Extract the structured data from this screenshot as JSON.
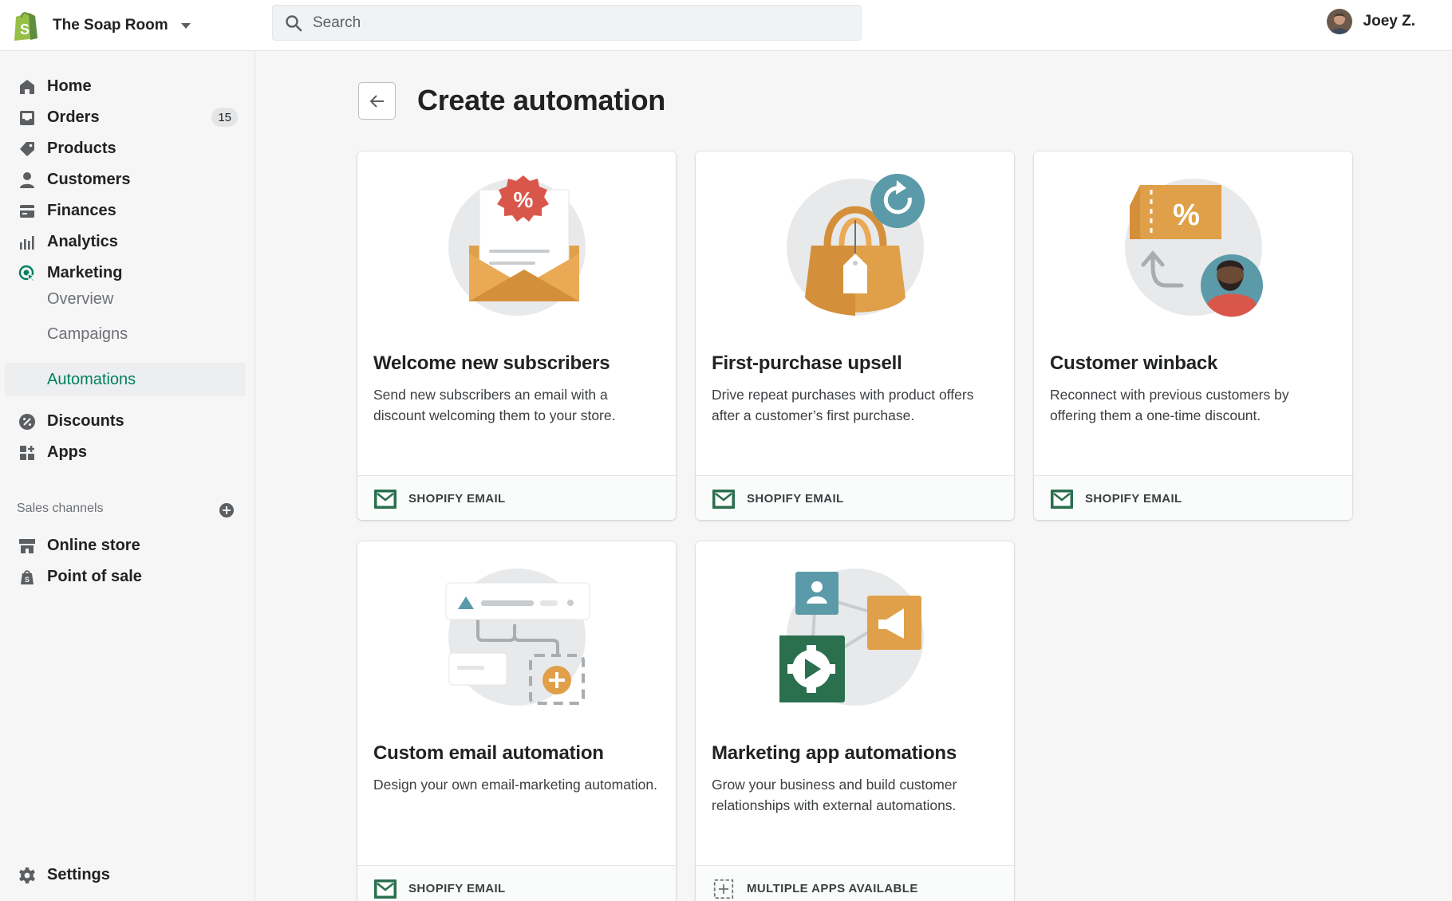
{
  "header": {
    "store_name": "The Soap Room",
    "search_placeholder": "Search",
    "user_name": "Joey Z."
  },
  "sidebar": {
    "items": [
      {
        "label": "Home",
        "icon": "home-icon"
      },
      {
        "label": "Orders",
        "icon": "orders-icon",
        "badge": "15"
      },
      {
        "label": "Products",
        "icon": "tag-icon"
      },
      {
        "label": "Customers",
        "icon": "person-icon"
      },
      {
        "label": "Finances",
        "icon": "finances-icon"
      },
      {
        "label": "Analytics",
        "icon": "analytics-icon"
      },
      {
        "label": "Marketing",
        "icon": "marketing-icon"
      }
    ],
    "marketing_sub": [
      "Overview",
      "Campaigns",
      "Automations"
    ],
    "active_sub": "Automations",
    "items_after": [
      {
        "label": "Discounts",
        "icon": "discount-icon"
      },
      {
        "label": "Apps",
        "icon": "apps-icon"
      }
    ],
    "sales_channels_title": "Sales channels",
    "channels": [
      {
        "label": "Online store",
        "icon": "store-icon"
      },
      {
        "label": "Point of sale",
        "icon": "pos-icon"
      }
    ],
    "settings_label": "Settings"
  },
  "main": {
    "title": "Create automation",
    "cards": [
      {
        "title": "Welcome new subscribers",
        "description": "Send new subscribers an email with a discount welcoming them to your store.",
        "footer": "SHOPIFY EMAIL",
        "icon": "envelope-discount-illustration"
      },
      {
        "title": "First-purchase upsell",
        "description": "Drive repeat purchases with product offers after a customer’s first purchase.",
        "footer": "SHOPIFY EMAIL",
        "icon": "shopping-bag-illustration"
      },
      {
        "title": "Customer winback",
        "description": "Reconnect with previous customers by offering them a one-time discount.",
        "footer": "SHOPIFY EMAIL",
        "icon": "coupon-customer-illustration"
      },
      {
        "title": "Custom email automation",
        "description": "Design your own email-marketing automation.",
        "footer": "SHOPIFY EMAIL",
        "icon": "workflow-illustration"
      },
      {
        "title": "Marketing app automations",
        "description": "Grow your business and build customer relationships with external automations.",
        "footer": "MULTIPLE APPS AVAILABLE",
        "icon": "apps-network-illustration"
      }
    ]
  },
  "colors": {
    "accent_green": "#008060",
    "dark_green": "#2a6f4e",
    "orange": "#e0a04a",
    "teal": "#5b9aa8",
    "red": "#d9574a"
  }
}
